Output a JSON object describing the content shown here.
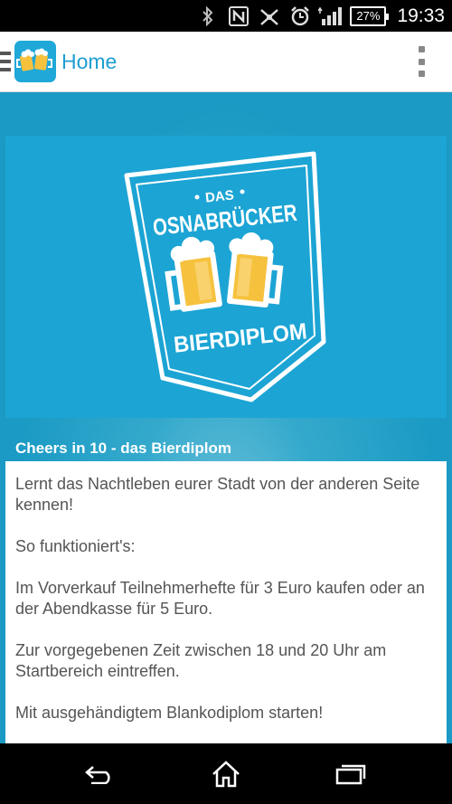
{
  "status_bar": {
    "icons": [
      "bluetooth-icon",
      "nfc-icon",
      "mute-icon",
      "alarm-icon",
      "signal-icon"
    ],
    "battery": "27%",
    "time": "19:33"
  },
  "action_bar": {
    "title": "Home",
    "accent_color": "#1e9ed1"
  },
  "banner": {
    "line1": "DAS",
    "line2": "OSNABRÜCKER",
    "line3": "BIERDIPLOM",
    "bg_color": "#1ca4d4"
  },
  "main": {
    "headline": "Cheers in 10 - das Bierdiplom",
    "paragraphs": [
      "Lernt das Nachtleben eurer Stadt von der anderen Seite kennen!",
      "So funktioniert's:",
      "Im Vorverkauf Teilnehmerhefte für 3 Euro kaufen oder an der Abendkasse für 5 Euro.",
      "Zur vorgegebenen Zeit zwischen 18 und 20 Uhr am Startbereich eintreffen.",
      "Mit ausgehändigtem Blankodiplom starten!"
    ]
  },
  "nav_bar": {
    "icons": [
      "back-icon",
      "home-icon",
      "recents-icon"
    ]
  }
}
